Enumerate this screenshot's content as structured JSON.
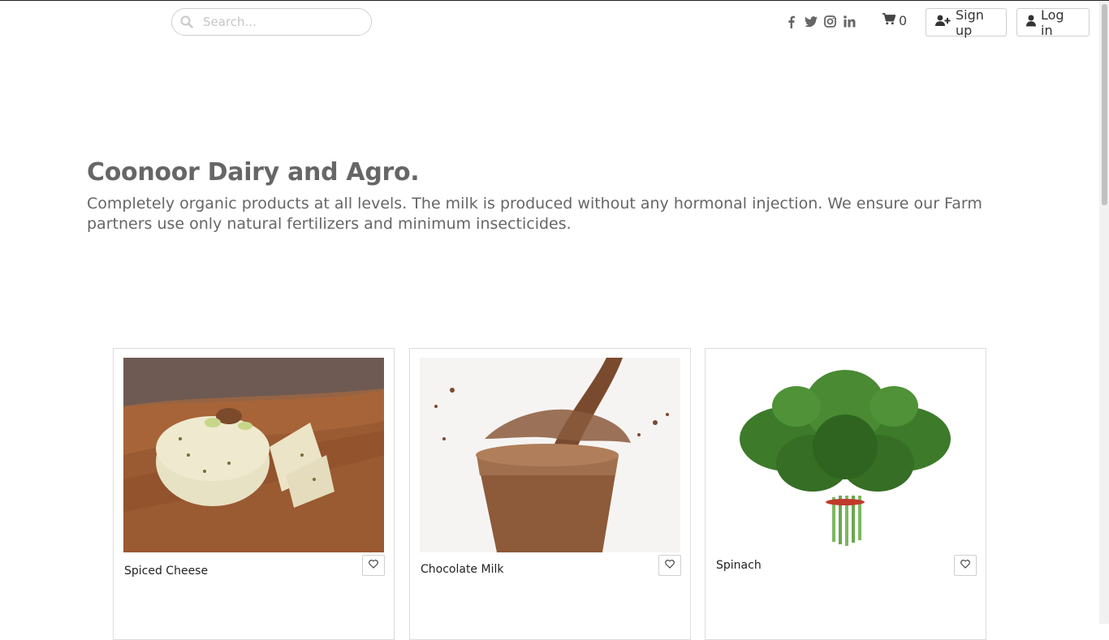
{
  "header": {
    "search": {
      "placeholder": "Search...",
      "value": ""
    },
    "social_icons": [
      "facebook-icon",
      "twitter-icon",
      "instagram-icon",
      "linkedin-icon"
    ],
    "cart": {
      "count": "0"
    },
    "signup_label": "Sign up",
    "login_label": "Log in"
  },
  "hero": {
    "title": "Coonoor Dairy and Agro.",
    "description": "Completely organic products at all levels. The milk is produced without any hormonal injection. We ensure our Farm partners use only natural fertilizers and minimum insecticides."
  },
  "products": [
    {
      "name": "Spiced Cheese"
    },
    {
      "name": "Chocolate Milk"
    },
    {
      "name": "Spinach"
    }
  ],
  "colors": {
    "text": "#666666",
    "border": "#dcdcdc"
  }
}
